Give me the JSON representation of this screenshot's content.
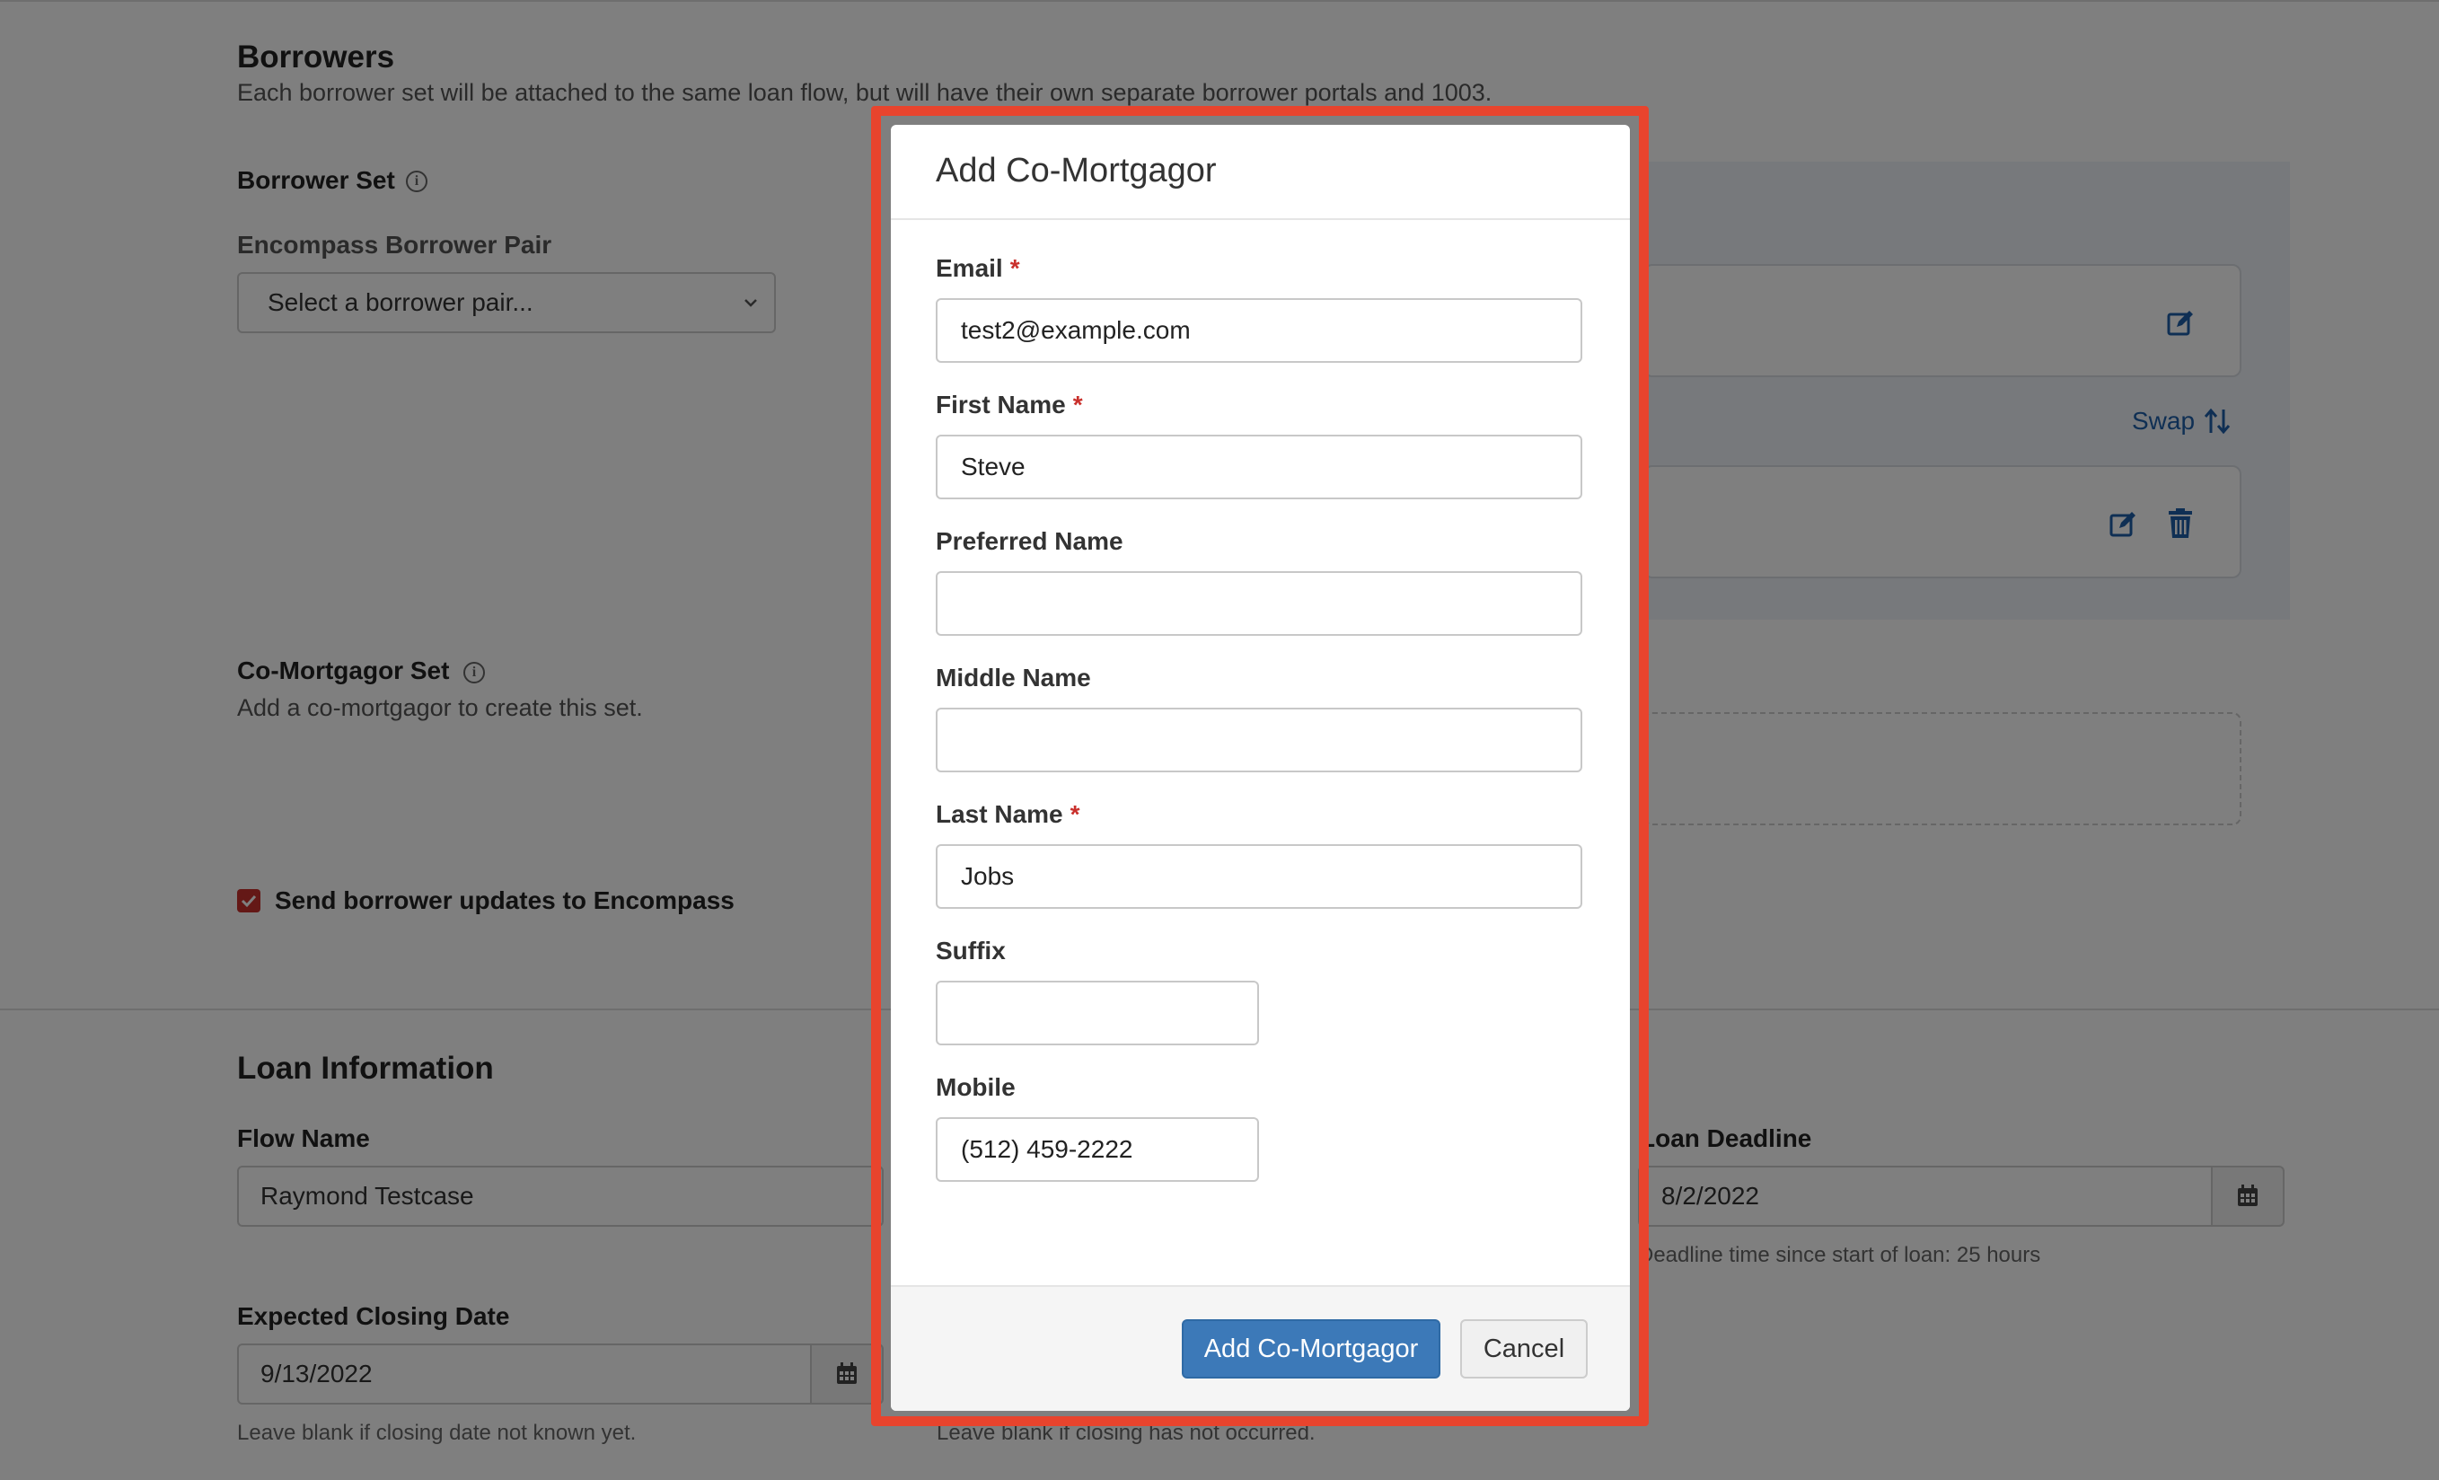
{
  "background": {
    "borrowers": {
      "title": "Borrowers",
      "description": "Each borrower set will be attached to the same loan flow, but will have their own separate borrower portals and 1003.",
      "borrower_set_label": "Borrower Set",
      "encompass_pair_label": "Encompass Borrower Pair",
      "encompass_pair_placeholder": "Select a borrower pair...",
      "swap_label": "Swap",
      "co_mortgagor_set_label": "Co-Mortgagor Set",
      "co_mortgagor_set_desc": "Add a co-mortgagor to create this set.",
      "send_updates_label": "Send borrower updates to Encompass",
      "send_updates_checked": true
    },
    "loan_info": {
      "title": "Loan Information",
      "flow_name_label": "Flow Name",
      "flow_name_value": "Raymond Testcase",
      "loan_deadline_label": "Loan Deadline",
      "loan_deadline_value": "8/2/2022",
      "loan_deadline_help": "Deadline time since start of loan: 25 hours",
      "expected_closing_label": "Expected Closing Date",
      "expected_closing_value": "9/13/2022",
      "expected_closing_help": "Leave blank if closing date not known yet.",
      "actual_closing_help": "Leave blank if closing has not occurred."
    }
  },
  "modal": {
    "title": "Add Co-Mortgagor",
    "fields": {
      "email": {
        "label": "Email",
        "value": "test2@example.com",
        "required": "*"
      },
      "first_name": {
        "label": "First Name",
        "value": "Steve",
        "required": "*"
      },
      "preferred_name": {
        "label": "Preferred Name",
        "value": ""
      },
      "middle_name": {
        "label": "Middle Name",
        "value": ""
      },
      "last_name": {
        "label": "Last Name",
        "value": "Jobs",
        "required": "*"
      },
      "suffix": {
        "label": "Suffix",
        "value": ""
      },
      "mobile": {
        "label": "Mobile",
        "value": "(512) 459-2222"
      }
    },
    "submit_label": "Add Co-Mortgagor",
    "cancel_label": "Cancel"
  },
  "icons": [
    "info-icon",
    "chevron-down-icon",
    "edit-icon",
    "trash-icon",
    "swap-arrows-icon",
    "calendar-icon",
    "checkmark-icon"
  ],
  "colors": {
    "primary_button": "#3c79b8",
    "required_asterisk": "#c9302c",
    "highlight_border": "#e8442d",
    "link_blue": "#1f5fa8",
    "overlay": "rgba(0,0,0,0.5)"
  }
}
